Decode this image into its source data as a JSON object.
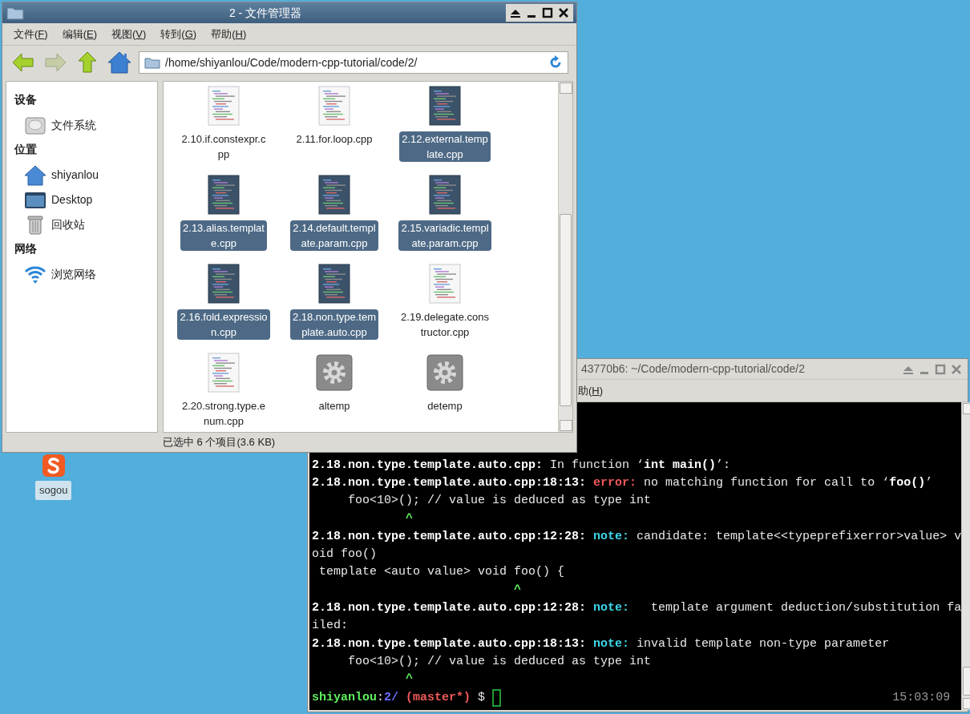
{
  "desktop": {
    "icons": [
      {
        "label": "sogou",
        "kind": "sogou"
      }
    ]
  },
  "file_manager": {
    "title": "2 - 文件管理器",
    "menu": [
      "文件(F)",
      "编辑(E)",
      "视图(V)",
      "转到(G)",
      "帮助(H)"
    ],
    "toolbar": [
      {
        "kind": "back",
        "disabled": false
      },
      {
        "kind": "forward",
        "disabled": true
      },
      {
        "kind": "up",
        "disabled": false
      },
      {
        "kind": "home",
        "disabled": false
      }
    ],
    "address": "/home/shiyanlou/Code/modern-cpp-tutorial/code/2/",
    "sidebar": [
      {
        "heading": "设备",
        "items": [
          {
            "label": "文件系统",
            "kind": "drive"
          }
        ]
      },
      {
        "heading": "位置",
        "items": [
          {
            "label": "shiyanlou",
            "kind": "home"
          },
          {
            "label": "Desktop",
            "kind": "desktop"
          },
          {
            "label": "回收站",
            "kind": "trash"
          }
        ]
      },
      {
        "heading": "网络",
        "items": [
          {
            "label": "浏览网络",
            "kind": "network"
          }
        ]
      }
    ],
    "files": [
      {
        "label_lines": [
          "2.10.if.constexpr.c",
          "pp"
        ],
        "kind": "source",
        "selected": false
      },
      {
        "label_lines": [
          "2.11.for.loop.cpp"
        ],
        "kind": "source",
        "selected": false
      },
      {
        "label_lines": [
          "2.12.external.temp",
          "late.cpp"
        ],
        "kind": "source",
        "selected": true
      },
      {
        "label_lines": [
          "2.13.alias.templat",
          "e.cpp"
        ],
        "kind": "source",
        "selected": true
      },
      {
        "label_lines": [
          "2.14.default.templ",
          "ate.param.cpp"
        ],
        "kind": "source",
        "selected": true
      },
      {
        "label_lines": [
          "2.15.variadic.templ",
          "ate.param.cpp"
        ],
        "kind": "source",
        "selected": true
      },
      {
        "label_lines": [
          "2.16.fold.expressio",
          "n.cpp"
        ],
        "kind": "source",
        "selected": true
      },
      {
        "label_lines": [
          "2.18.non.type.tem",
          "plate.auto.cpp"
        ],
        "kind": "source",
        "selected": true
      },
      {
        "label_lines": [
          "2.19.delegate.cons",
          "tructor.cpp"
        ],
        "kind": "source",
        "selected": false
      },
      {
        "label_lines": [
          "2.20.strong.type.e",
          "num.cpp"
        ],
        "kind": "source",
        "selected": false
      },
      {
        "label_lines": [
          "altemp"
        ],
        "kind": "executable",
        "selected": false
      },
      {
        "label_lines": [
          "detemp"
        ],
        "kind": "executable",
        "selected": false
      }
    ],
    "status": "已选中 6 个项目(3.6 KB)"
  },
  "terminal": {
    "title": "43770b6: ~/Code/modern-cpp-tutorial/code/2",
    "menu": [
      "助(H)"
    ],
    "lines": [
      {
        "segments": [
          {
            "text": "2.18.non.type.template.auto.cpp:",
            "kind": "bold"
          },
          {
            "text": " In function ‘",
            "kind": "plain"
          },
          {
            "text": "int main()",
            "kind": "bold"
          },
          {
            "text": "’:",
            "kind": "plain"
          }
        ]
      },
      {
        "segments": [
          {
            "text": "2.18.non.type.template.auto.cpp:18:13:",
            "kind": "bold"
          },
          {
            "text": " error:",
            "kind": "error"
          },
          {
            "text": " no matching function for call to ‘",
            "kind": "plain"
          },
          {
            "text": "foo()",
            "kind": "bold"
          },
          {
            "text": "’",
            "kind": "plain"
          }
        ]
      },
      {
        "segments": [
          {
            "text": "     foo<10>(); // value is deduced as type int",
            "kind": "plain"
          }
        ]
      },
      {
        "segments": [
          {
            "text": "             ^",
            "kind": "caret"
          }
        ]
      },
      {
        "segments": [
          {
            "text": "2.18.non.type.template.auto.cpp:12:28:",
            "kind": "bold"
          },
          {
            "text": " note:",
            "kind": "note"
          },
          {
            "text": " candidate: template<<typeprefixerror>value> v",
            "kind": "plain"
          }
        ]
      },
      {
        "segments": [
          {
            "text": "oid foo()",
            "kind": "plain"
          }
        ]
      },
      {
        "segments": [
          {
            "text": " template <auto value> void foo() {",
            "kind": "plain"
          }
        ]
      },
      {
        "segments": [
          {
            "text": "                            ^",
            "kind": "caret"
          }
        ]
      },
      {
        "segments": [
          {
            "text": "2.18.non.type.template.auto.cpp:12:28:",
            "kind": "bold"
          },
          {
            "text": " note:",
            "kind": "note"
          },
          {
            "text": "   template argument deduction/substitution fa",
            "kind": "plain"
          }
        ]
      },
      {
        "segments": [
          {
            "text": "iled:",
            "kind": "plain"
          }
        ]
      },
      {
        "segments": [
          {
            "text": "2.18.non.type.template.auto.cpp:18:13:",
            "kind": "bold"
          },
          {
            "text": " note:",
            "kind": "note"
          },
          {
            "text": " invalid template non-type parameter",
            "kind": "plain"
          }
        ]
      },
      {
        "segments": [
          {
            "text": "     foo<10>(); // value is deduced as type int",
            "kind": "plain"
          }
        ]
      },
      {
        "segments": [
          {
            "text": "             ^",
            "kind": "caret"
          }
        ]
      },
      {
        "segments": [
          {
            "text": "shiyanlou",
            "kind": "user"
          },
          {
            "text": ":",
            "kind": "plain"
          },
          {
            "text": "2/",
            "kind": "dir"
          },
          {
            "text": " (master*)",
            "kind": "branch"
          },
          {
            "text": " $ ",
            "kind": "plain"
          }
        ],
        "cursor": true
      }
    ],
    "clock": "15:03:09"
  }
}
